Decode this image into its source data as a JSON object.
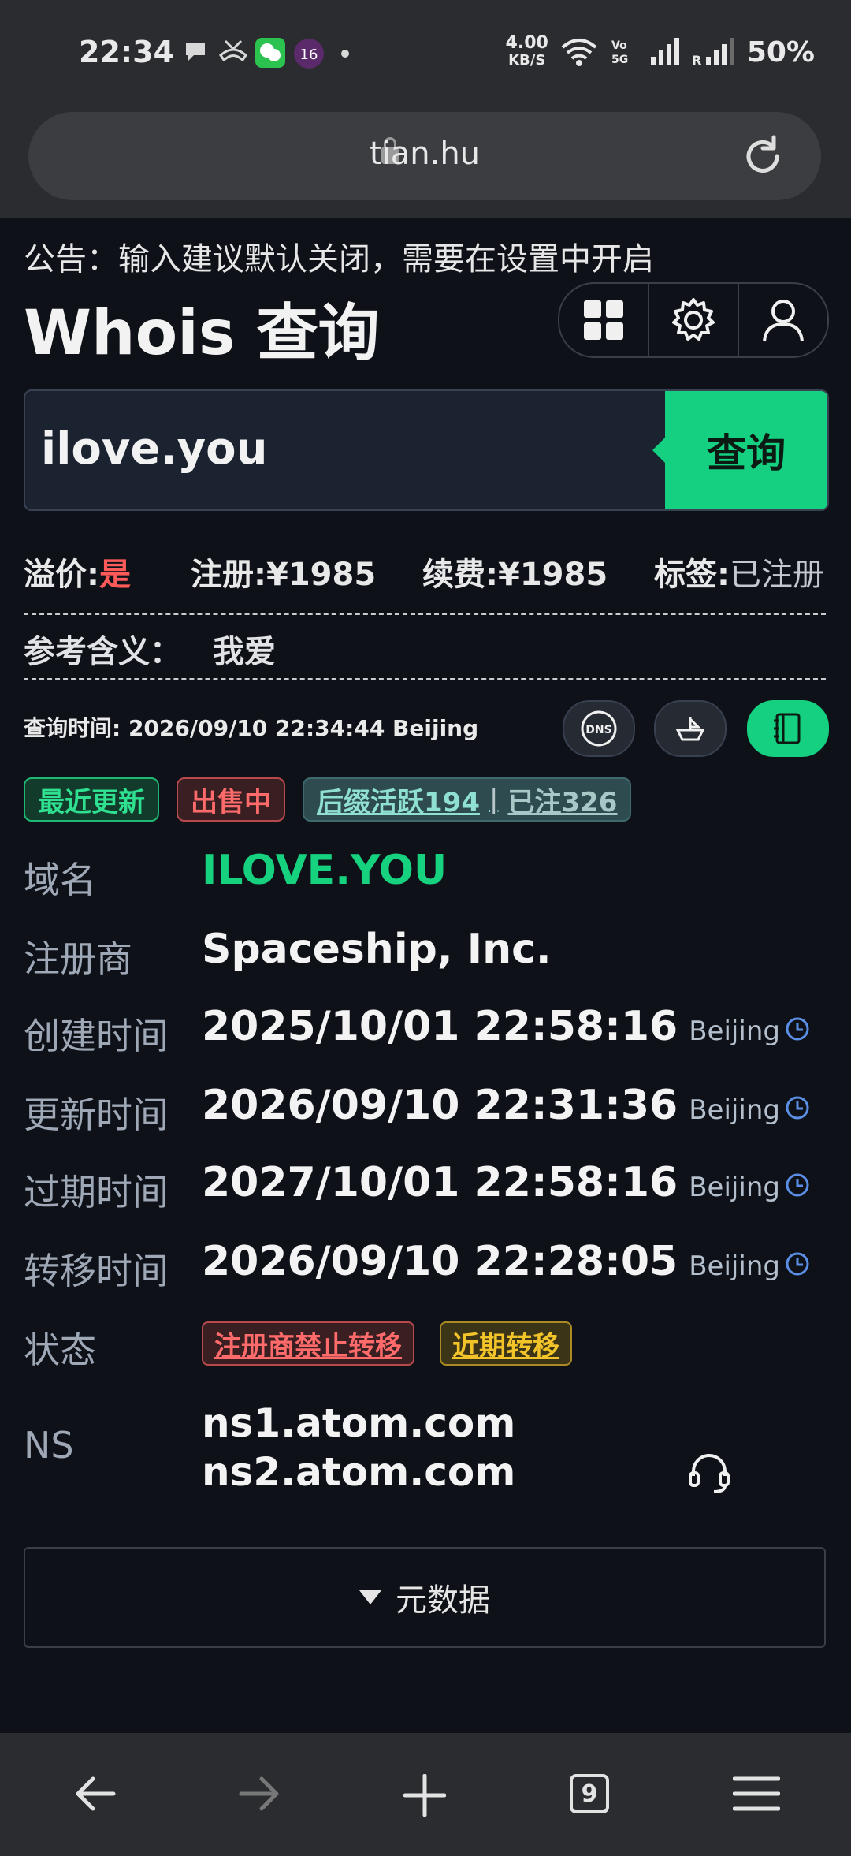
{
  "status_bar": {
    "time": "22:34",
    "net_speed": "4.00",
    "net_unit": "KB/S",
    "battery": "50%"
  },
  "browser": {
    "url": "tian.hu",
    "tab_count": "9"
  },
  "notice": "公告：输入建议默认关闭，需要在设置中开启",
  "page_title": "Whois 查询",
  "search": {
    "value": "ilove.you",
    "button": "查询"
  },
  "price": {
    "premium_label": "溢价:",
    "premium_value": "是",
    "register_label": "注册:",
    "register_value": "¥1985",
    "renew_label": "续费:",
    "renew_value": "¥1985",
    "tag_label": "标签:",
    "tag_value": "已注册"
  },
  "meaning": {
    "label": "参考含义：",
    "value": "我爱"
  },
  "query_time": "查询时间: 2026/09/10 22:34:44 Beijing",
  "tags": {
    "recent": "最近更新",
    "for_sale": "出售中",
    "suffix_active": "后缀活跃194",
    "registered": "已注326"
  },
  "whois": {
    "domain_label": "域名",
    "domain": "ILOVE.YOU",
    "registrar_label": "注册商",
    "registrar": "Spaceship, Inc.",
    "created_label": "创建时间",
    "created": "2025/10/01 22:58:16",
    "updated_label": "更新时间",
    "updated": "2026/09/10 22:31:36",
    "expires_label": "过期时间",
    "expires": "2027/10/01 22:58:16",
    "transfer_label": "转移时间",
    "transfer": "2026/09/10 22:28:05",
    "tz": "Beijing",
    "status_label": "状态",
    "status_1": "注册商禁止转移",
    "status_2": "近期转移",
    "ns_label": "NS",
    "ns_1": "ns1.atom.com",
    "ns_2": "ns2.atom.com"
  },
  "metadata_toggle": "元数据",
  "colors": {
    "accent": "#14d080",
    "danger": "#ff5a5a",
    "warning": "#f2c42a",
    "background": "#0e1117"
  },
  "icons": [
    "grid-icon",
    "gear-icon",
    "user-icon",
    "dns-icon",
    "boat-icon",
    "notebook-icon",
    "clock-icon",
    "headset-icon",
    "back-icon",
    "forward-icon",
    "plus-icon",
    "menu-icon",
    "lock-icon",
    "reload-icon"
  ]
}
